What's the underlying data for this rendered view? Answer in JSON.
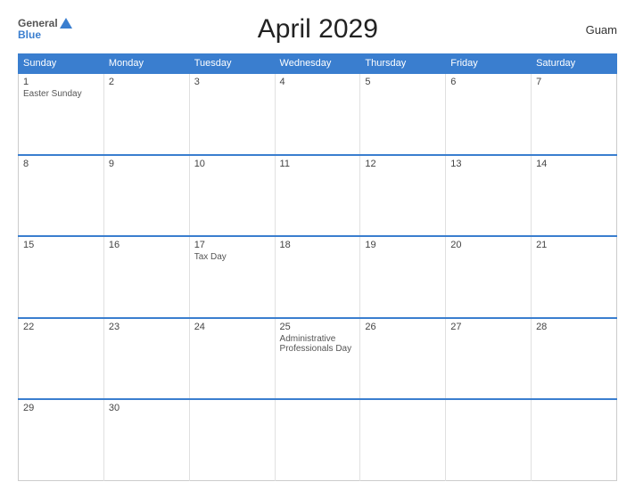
{
  "logo": {
    "line1": "General",
    "line2": "Blue"
  },
  "title": "April 2029",
  "region": "Guam",
  "days_header": [
    "Sunday",
    "Monday",
    "Tuesday",
    "Wednesday",
    "Thursday",
    "Friday",
    "Saturday"
  ],
  "weeks": [
    [
      {
        "day": "1",
        "event": "Easter Sunday"
      },
      {
        "day": "2",
        "event": ""
      },
      {
        "day": "3",
        "event": ""
      },
      {
        "day": "4",
        "event": ""
      },
      {
        "day": "5",
        "event": ""
      },
      {
        "day": "6",
        "event": ""
      },
      {
        "day": "7",
        "event": ""
      }
    ],
    [
      {
        "day": "8",
        "event": ""
      },
      {
        "day": "9",
        "event": ""
      },
      {
        "day": "10",
        "event": ""
      },
      {
        "day": "11",
        "event": ""
      },
      {
        "day": "12",
        "event": ""
      },
      {
        "day": "13",
        "event": ""
      },
      {
        "day": "14",
        "event": ""
      }
    ],
    [
      {
        "day": "15",
        "event": ""
      },
      {
        "day": "16",
        "event": ""
      },
      {
        "day": "17",
        "event": "Tax Day"
      },
      {
        "day": "18",
        "event": ""
      },
      {
        "day": "19",
        "event": ""
      },
      {
        "day": "20",
        "event": ""
      },
      {
        "day": "21",
        "event": ""
      }
    ],
    [
      {
        "day": "22",
        "event": ""
      },
      {
        "day": "23",
        "event": ""
      },
      {
        "day": "24",
        "event": ""
      },
      {
        "day": "25",
        "event": "Administrative Professionals Day"
      },
      {
        "day": "26",
        "event": ""
      },
      {
        "day": "27",
        "event": ""
      },
      {
        "day": "28",
        "event": ""
      }
    ],
    [
      {
        "day": "29",
        "event": ""
      },
      {
        "day": "30",
        "event": ""
      },
      {
        "day": "",
        "event": ""
      },
      {
        "day": "",
        "event": ""
      },
      {
        "day": "",
        "event": ""
      },
      {
        "day": "",
        "event": ""
      },
      {
        "day": "",
        "event": ""
      }
    ]
  ]
}
